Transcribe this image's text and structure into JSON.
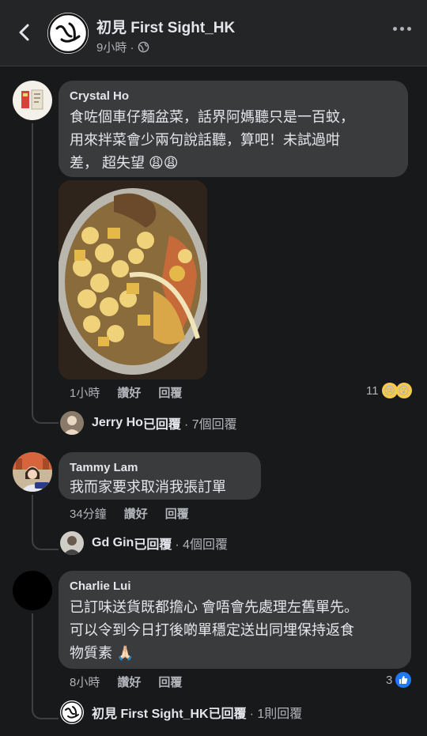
{
  "header": {
    "page_name": "初見 First Sight_HK",
    "post_time": "9小時 ·",
    "logo_text": "初見"
  },
  "comments": [
    {
      "author": "Crystal Ho",
      "text_lines": [
        "食咗個車仔麵盆菜，話界阿媽聽只是一百蚊，",
        "用來拌菜會少兩句說話聽，算吧！未試過咁",
        "差， 超失望 😩😩"
      ],
      "time": "1小時",
      "like_label": "讚好",
      "reply_label": "回覆",
      "reaction_count": "11",
      "reply_summary": {
        "name": "Jerry Ho",
        "replied": "已回覆",
        "count": "· 7個回覆"
      }
    },
    {
      "author": "Tammy Lam",
      "text_lines": [
        "我而家要求取消我張訂單"
      ],
      "time": "34分鐘",
      "like_label": "讚好",
      "reply_label": "回覆",
      "reply_summary": {
        "name": "Gd Gin",
        "replied": "已回覆",
        "count": "· 4個回覆"
      }
    },
    {
      "author": "Charlie Lui",
      "text_lines": [
        "已訂味送貨既都擔心 會唔會先處理左舊單先。",
        "可以令到今日打後啲單穩定送出同埋保持返食",
        "物質素 🙏🏻"
      ],
      "time": "8小時",
      "like_label": "讚好",
      "reply_label": "回覆",
      "reaction_count": "3",
      "reply_summary": {
        "name": "初見 First Sight_HK",
        "replied": "已回覆",
        "count": "· 1則回覆"
      }
    }
  ],
  "colors": {
    "background": "#18191a",
    "bubble": "#3a3b3c",
    "like_blue": "#2078f4"
  }
}
